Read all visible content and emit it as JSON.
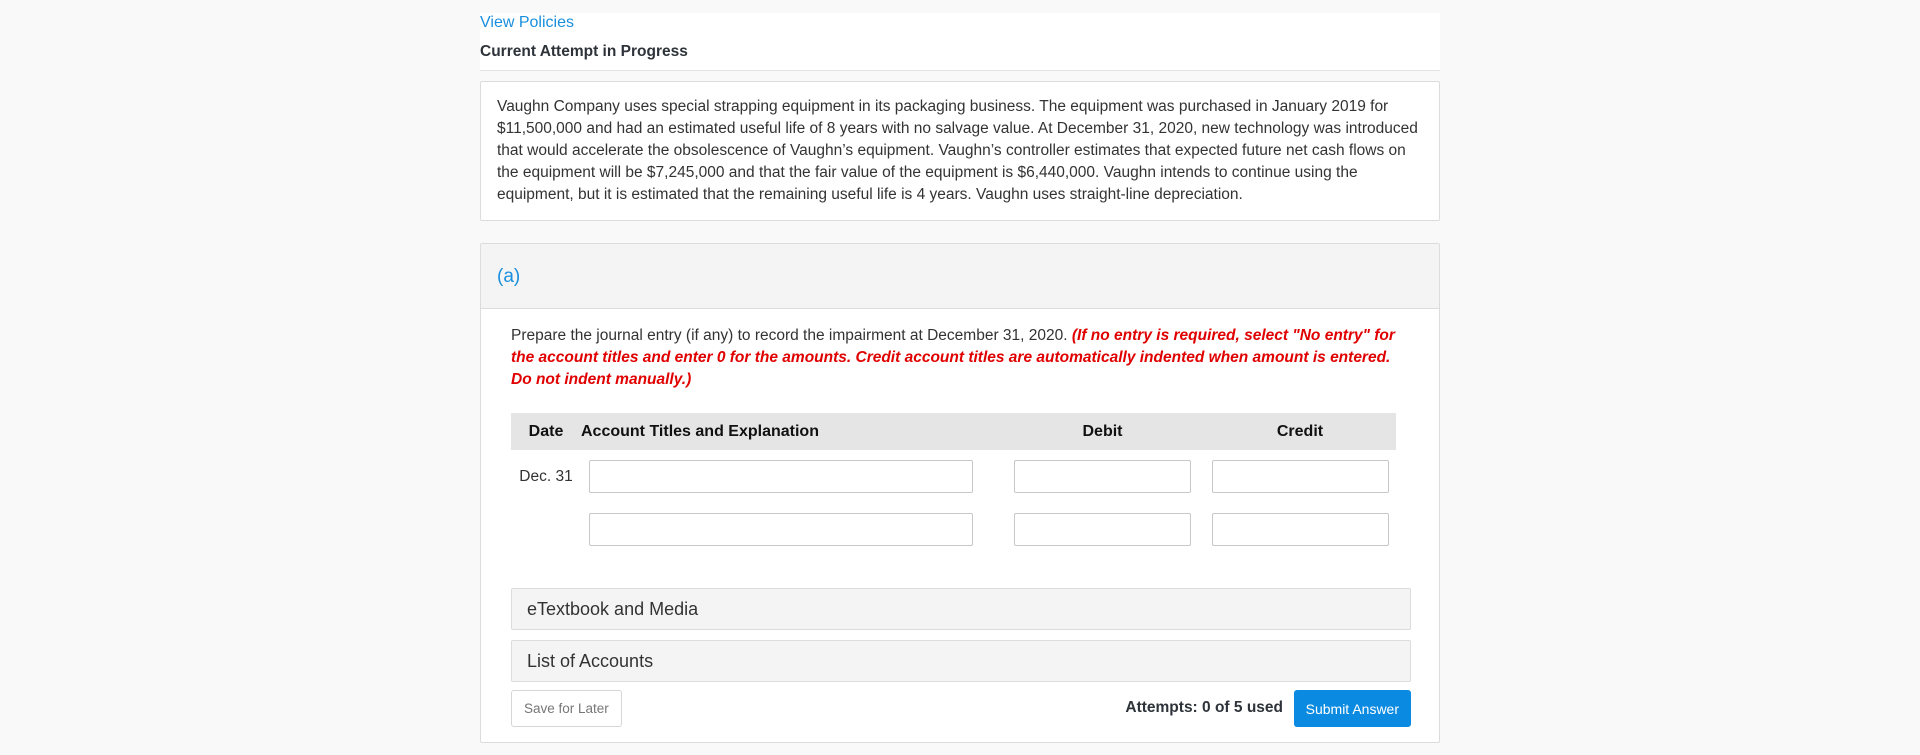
{
  "header": {
    "policies_link": "View Policies",
    "attempt_status": "Current Attempt in Progress"
  },
  "problem": {
    "text": "Vaughn Company uses special strapping equipment in its packaging business. The equipment was purchased in January 2019 for $11,500,000 and had an estimated useful life of 8 years with no salvage value. At December 31, 2020, new technology was introduced that would accelerate the obsolescence of Vaughn’s equipment. Vaughn’s controller estimates that expected future net cash flows on the equipment will be $7,245,000 and that the fair value of the equipment is $6,440,000. Vaughn intends to continue using the equipment, but it is estimated that the remaining useful life is 4 years. Vaughn uses straight-line depreciation."
  },
  "part": {
    "label": "(a)",
    "instruction": "Prepare the journal entry (if any) to record the impairment at December 31, 2020.",
    "instruction_note": "(If no entry is required, select \"No entry\" for the account titles and enter 0 for the amounts. Credit account titles are automatically indented when amount is entered. Do not indent manually.)",
    "table": {
      "headers": {
        "date": "Date",
        "account": "Account Titles and Explanation",
        "debit": "Debit",
        "credit": "Credit"
      },
      "rows": [
        {
          "date": "Dec. 31",
          "account": "",
          "debit": "",
          "credit": ""
        },
        {
          "date": "",
          "account": "",
          "debit": "",
          "credit": ""
        }
      ]
    },
    "etextbook_label": "eTextbook and Media",
    "accounts_label": "List of Accounts",
    "save_label": "Save for Later",
    "attempts_text": "Attempts: 0 of 5 used",
    "submit_label": "Submit Answer"
  },
  "colors": {
    "link": "#1a8fdd",
    "warning": "#e00000",
    "submit": "#0a8ae0"
  }
}
